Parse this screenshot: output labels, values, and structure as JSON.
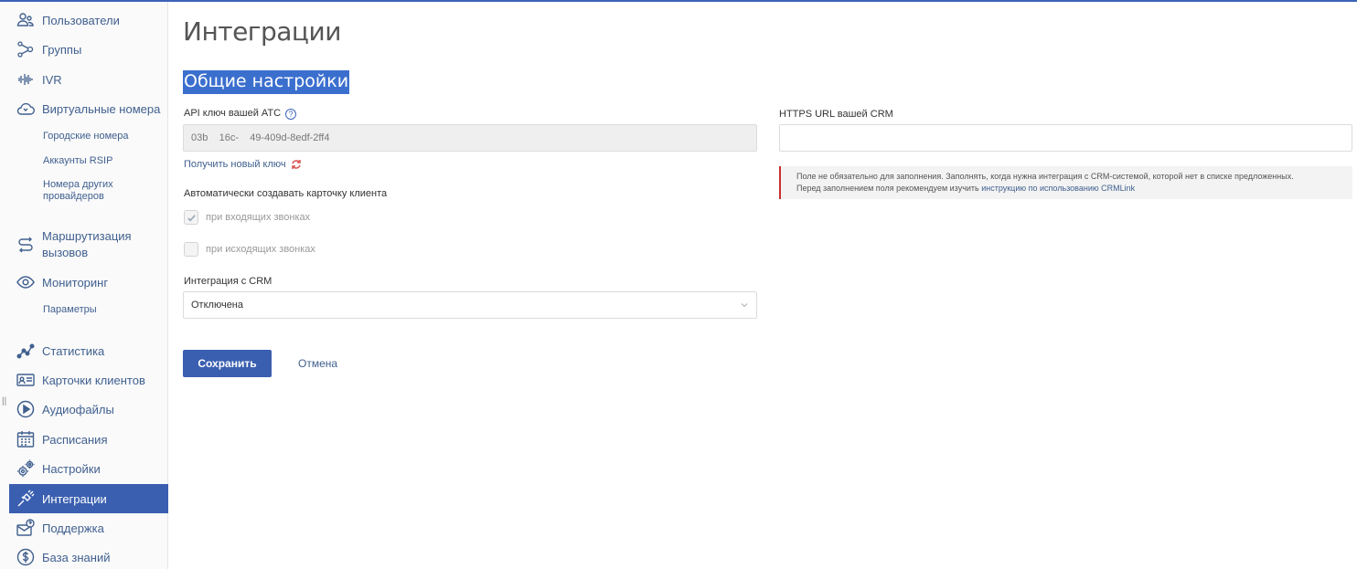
{
  "sidebar": {
    "items": [
      {
        "label": "Пользователи",
        "icon": "users-icon"
      },
      {
        "label": "Группы",
        "icon": "groups-icon"
      },
      {
        "label": "IVR",
        "icon": "ivr-waveform-icon"
      },
      {
        "label": "Виртуальные номера",
        "icon": "cloud-phone-icon"
      },
      {
        "label": "Маршрутизация вызовов",
        "icon": "routing-icon"
      },
      {
        "label": "Мониторинг",
        "icon": "eye-icon"
      },
      {
        "label": "Статистика",
        "icon": "statistics-icon"
      },
      {
        "label": "Карточки клиентов",
        "icon": "client-card-icon"
      },
      {
        "label": "Аудиофайлы",
        "icon": "play-icon"
      },
      {
        "label": "Расписания",
        "icon": "calendar-icon"
      },
      {
        "label": "Настройки",
        "icon": "gears-icon"
      },
      {
        "label": "Интеграции",
        "icon": "plug-icon"
      },
      {
        "label": "Поддержка",
        "icon": "support-mail-icon"
      },
      {
        "label": "База знаний",
        "icon": "knowledge-base-icon"
      }
    ],
    "sub_virtual": [
      "Городские номера",
      "Аккаунты RSIP",
      "Номера других провайдеров"
    ],
    "sub_monitoring": [
      "Параметры"
    ],
    "active": "Интеграции",
    "active_color": "#3a5fb0"
  },
  "main": {
    "title": "Интеграции",
    "section_title": "Общие настройки",
    "api_key": {
      "label": "API ключ вашей АТС",
      "help": "?",
      "value": "03b    16c-    49-409d-8edf-2ff4",
      "new_key_link": "Получить новый ключ"
    },
    "auto_card": {
      "label": "Автоматически создавать карточку клиента",
      "incoming": {
        "label": "при входящих звонках",
        "checked": true
      },
      "outgoing": {
        "label": "при исходящих звонках",
        "checked": false
      }
    },
    "crm_integration": {
      "label": "Интеграция с CRM",
      "selected": "Отключена"
    },
    "buttons": {
      "save": "Сохранить",
      "cancel": "Отмена"
    },
    "crm_url": {
      "label": "HTTPS URL вашей CRM",
      "value": "",
      "notice_line1": "Поле не обязательно для заполнения. Заполнять, когда нужна интеграция с CRM-системой, которой нет в списке предложенных.",
      "notice_line2_prefix": "Перед заполнением поля рекомендуем изучить ",
      "notice_link": "инструкцию по использованию CRMLink"
    },
    "colors": {
      "primary": "#3a5fb0",
      "highlight": "#3b6fce",
      "link": "#40608f",
      "warning_border": "#c9302c"
    }
  }
}
